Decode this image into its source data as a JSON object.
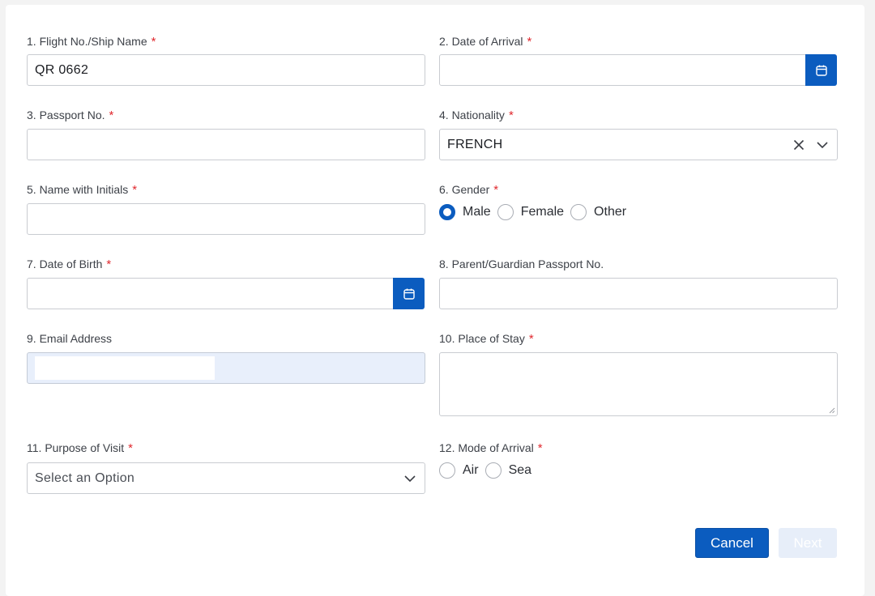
{
  "form": {
    "flight": {
      "label": "1. Flight No./Ship Name",
      "required": "*",
      "value": "QR 0662"
    },
    "arrival_date": {
      "label": "2. Date of Arrival",
      "required": "*",
      "value": ""
    },
    "passport": {
      "label": "3. Passport No.",
      "required": "*",
      "value": ""
    },
    "nationality": {
      "label": "4. Nationality",
      "required": "*",
      "value": "FRENCH"
    },
    "name": {
      "label": "5. Name with Initials",
      "required": "*",
      "value": ""
    },
    "gender": {
      "label": "6. Gender",
      "required": "*",
      "options": [
        "Male",
        "Female",
        "Other"
      ],
      "selected": "Male"
    },
    "dob": {
      "label": "7. Date of Birth",
      "required": "*",
      "value": ""
    },
    "guardian": {
      "label": "8. Parent/Guardian Passport No.",
      "value": ""
    },
    "email": {
      "label": "9. Email Address",
      "value": ""
    },
    "stay": {
      "label": "10. Place of Stay",
      "required": "*",
      "value": ""
    },
    "purpose": {
      "label": "11. Purpose of Visit",
      "required": "*",
      "placeholder": "Select an Option"
    },
    "mode": {
      "label": "12. Mode of Arrival",
      "required": "*",
      "options": [
        "Air",
        "Sea"
      ],
      "selected": ""
    }
  },
  "actions": {
    "cancel": "Cancel",
    "next": "Next"
  },
  "colors": {
    "primary": "#0b5cbf",
    "required": "#e0282e",
    "disabled_bg": "#e7eef9",
    "autofill_bg": "#e8effb"
  },
  "icons": {
    "calendar": "calendar-icon",
    "clear": "close-icon",
    "dropdown": "chevron-down-icon"
  }
}
